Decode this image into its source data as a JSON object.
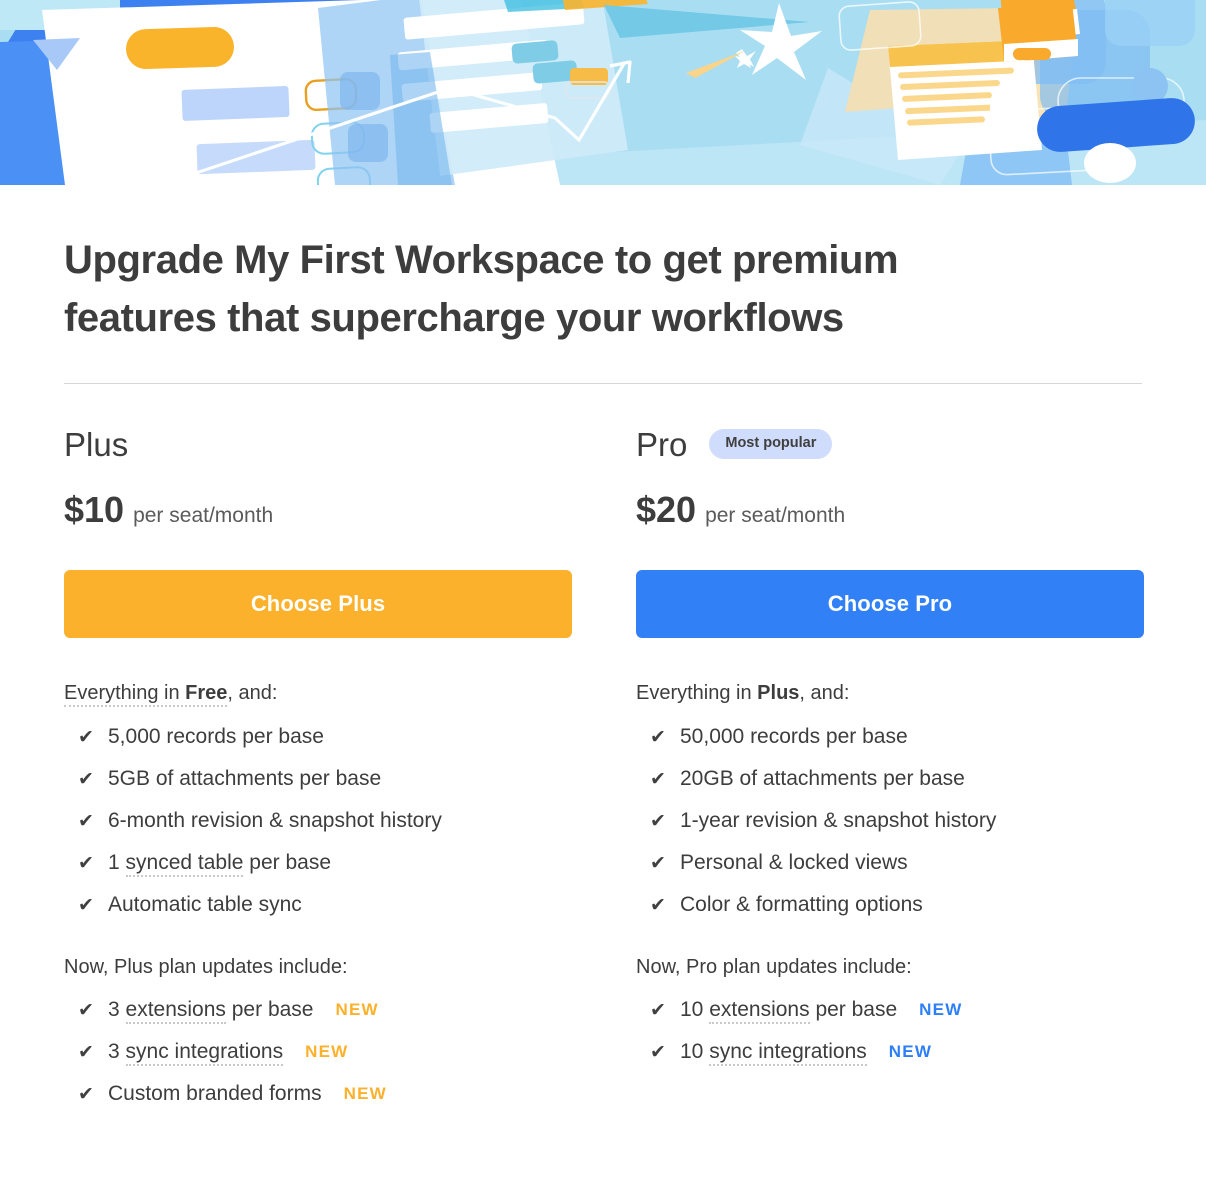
{
  "hero": {
    "alt": "premium-features-illustration",
    "colors": {
      "sky": "#A9DEF2",
      "blue": "#3D80F0",
      "light_blue": "#8EC6F5",
      "yellow": "#F9B42C",
      "cream": "#F7E3B6",
      "white": "#FFFFFF"
    }
  },
  "page": {
    "title": "Upgrade My First Workspace to get premium features that supercharge your workflows",
    "workspace_name": "My First Workspace"
  },
  "plans": [
    {
      "id": "plus",
      "name": "Plus",
      "badge": null,
      "price": "$10",
      "price_unit": "per seat/month",
      "cta_label": "Choose Plus",
      "cta_color": "#fbb12c",
      "inherits_prefix": "Everything in ",
      "inherits_plan": "Free",
      "inherits_suffix": ", and:",
      "inherits_dotted": true,
      "features": [
        {
          "text": "5,000 records per base",
          "dotted": null,
          "new": false
        },
        {
          "text": "5GB of attachments per base",
          "dotted": null,
          "new": false
        },
        {
          "text": "6-month revision & snapshot history",
          "dotted": null,
          "new": false
        },
        {
          "pre": "1 ",
          "dotted": "synced table",
          "post": " per base",
          "new": false
        },
        {
          "text": "Automatic table sync",
          "dotted": null,
          "new": false
        }
      ],
      "updates_heading": "Now, Plus plan updates include:",
      "updates": [
        {
          "pre": "3 ",
          "dotted": "extensions",
          "post": " per base",
          "new_label": "NEW"
        },
        {
          "pre": "3 ",
          "dotted": "sync integrations",
          "post": "",
          "new_label": "NEW"
        },
        {
          "pre": "Custom branded forms",
          "dotted": "",
          "post": "",
          "new_label": "NEW"
        }
      ],
      "new_color": "#fbb12c"
    },
    {
      "id": "pro",
      "name": "Pro",
      "badge": "Most popular",
      "price": "$20",
      "price_unit": "per seat/month",
      "cta_label": "Choose Pro",
      "cta_color": "#3280f6",
      "inherits_prefix": "Everything in ",
      "inherits_plan": "Plus",
      "inherits_suffix": ", and:",
      "inherits_dotted": false,
      "features": [
        {
          "text": "50,000 records per base",
          "dotted": null,
          "new": false
        },
        {
          "text": "20GB of attachments per base",
          "dotted": null,
          "new": false
        },
        {
          "text": "1-year revision & snapshot history",
          "dotted": null,
          "new": false
        },
        {
          "text": "Personal & locked views",
          "dotted": null,
          "new": false
        },
        {
          "text": "Color & formatting options",
          "dotted": null,
          "new": false
        }
      ],
      "updates_heading": "Now, Pro plan updates include:",
      "updates": [
        {
          "pre": "10 ",
          "dotted": "extensions",
          "post": " per base",
          "new_label": "NEW"
        },
        {
          "pre": "10 ",
          "dotted": "sync integrations",
          "post": "",
          "new_label": "NEW"
        }
      ],
      "new_color": "#2d7ff9"
    }
  ],
  "icons": {
    "check": "✔"
  }
}
